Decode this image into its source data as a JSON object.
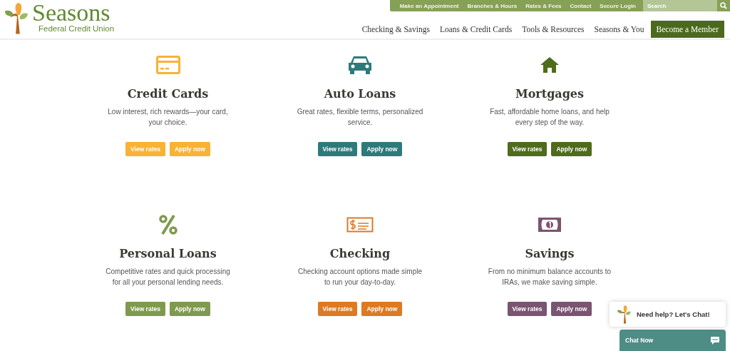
{
  "logo": {
    "name": "Seasons",
    "subtitle": "Federal Credit Union"
  },
  "utility_links": [
    "Make an Appointment",
    "Branches & Hours",
    "Rates & Fees",
    "Contact",
    "Secure Login"
  ],
  "search": {
    "placeholder": "Search"
  },
  "nav": [
    "Checking & Savings",
    "Loans & Credit Cards",
    "Tools & Resources",
    "Seasons & You"
  ],
  "cta": "Become a Member",
  "cards": [
    {
      "title": "Credit Cards",
      "description": "Low interest, rich rewards—your card, your choice.",
      "color": "#f9b233",
      "buttons": [
        "View rates",
        "Apply now"
      ]
    },
    {
      "title": "Auto Loans",
      "description": "Great rates, flexible terms, personalized service.",
      "color": "#2e7a7b",
      "buttons": [
        "View rates",
        "Apply now"
      ]
    },
    {
      "title": "Mortgages",
      "description": "Fast, affordable home loans, and help every step of the way.",
      "color": "#4f6b1c",
      "buttons": [
        "View rates",
        "Apply now"
      ]
    },
    {
      "title": "Personal Loans",
      "description": "Competitive rates and quick processing for all your personal lending needs.",
      "color": "#7f9a4e",
      "buttons": [
        "View rates",
        "Apply now"
      ]
    },
    {
      "title": "Checking",
      "description": "Checking account options made simple to run your day-to-day.",
      "color": "#dd7a22",
      "buttons": [
        "View rates",
        "Apply now"
      ]
    },
    {
      "title": "Savings",
      "description": "From no minimum balance accounts to IRAs, we make saving simple.",
      "color": "#7a5470",
      "buttons": [
        "View rates",
        "Apply now"
      ]
    }
  ],
  "chat": {
    "prompt": "Need help? Let's Chat!",
    "button": "Chat Now"
  }
}
